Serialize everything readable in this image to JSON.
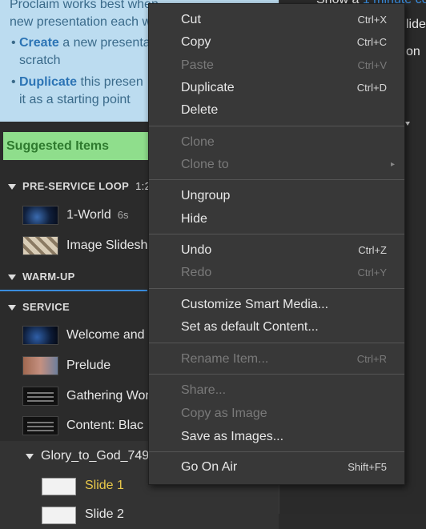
{
  "info": {
    "line1": "Proclaim works best when",
    "line2": "new presentation each w",
    "bullets": [
      {
        "bold": "Create",
        "rest": " a new presenta",
        "cont": "scratch"
      },
      {
        "bold": "Duplicate",
        "rest": " this presen",
        "cont": "it as a starting point"
      }
    ]
  },
  "suggested_label": "Suggested Items",
  "sections": {
    "preservice": {
      "title": "PRE-SERVICE LOOP",
      "time": "1:2"
    },
    "warmup": {
      "title": "WARM-UP"
    },
    "service": {
      "title": "SERVICE"
    }
  },
  "items": {
    "world": {
      "label": "1-World",
      "duration": "6s"
    },
    "image_slideshow": {
      "label": "Image Slidesh"
    },
    "welcome": {
      "label": "Welcome and"
    },
    "prelude": {
      "label": "Prelude"
    },
    "gathering": {
      "label": "Gathering Wor"
    },
    "content_black": {
      "label": "Content: Blac"
    }
  },
  "group": {
    "label": "Glory_to_God_749"
  },
  "slides": [
    {
      "label": "Slide 1",
      "selected": true,
      "color": "#e8c84a"
    },
    {
      "label": "Slide 2",
      "selected": false,
      "color": "#e8e8e8"
    }
  ],
  "right_panel": {
    "line1_prefix": "Show a",
    "line1_link": "1 minute co",
    "line2": "lide",
    "line3": "on"
  },
  "menu": {
    "cut": {
      "label": "Cut",
      "shortcut": "Ctrl+X"
    },
    "copy": {
      "label": "Copy",
      "shortcut": "Ctrl+C"
    },
    "paste": {
      "label": "Paste",
      "shortcut": "Ctrl+V"
    },
    "duplicate": {
      "label": "Duplicate",
      "shortcut": "Ctrl+D"
    },
    "delete": {
      "label": "Delete"
    },
    "clone": {
      "label": "Clone"
    },
    "clone_to": {
      "label": "Clone to",
      "arrow": "▸"
    },
    "ungroup": {
      "label": "Ungroup"
    },
    "hide": {
      "label": "Hide"
    },
    "undo": {
      "label": "Undo",
      "shortcut": "Ctrl+Z"
    },
    "redo": {
      "label": "Redo",
      "shortcut": "Ctrl+Y"
    },
    "customize": {
      "label": "Customize Smart Media..."
    },
    "set_default": {
      "label": "Set as default Content..."
    },
    "rename": {
      "label": "Rename Item...",
      "shortcut": "Ctrl+R"
    },
    "share": {
      "label": "Share..."
    },
    "copy_image": {
      "label": "Copy as Image"
    },
    "save_images": {
      "label": "Save as Images..."
    },
    "go_on_air": {
      "label": "Go On Air",
      "shortcut": "Shift+F5"
    }
  },
  "colors": {
    "accent": "#3a8dde",
    "selected_text": "#e8c84a",
    "suggested_bg": "#8fde8c",
    "info_bg": "#bcdcf0"
  }
}
